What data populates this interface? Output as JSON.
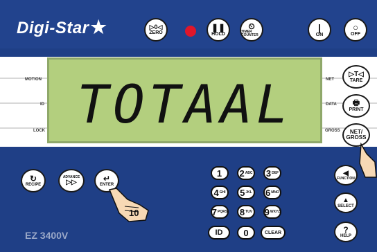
{
  "brand": {
    "name": "Digi-Star",
    "star": "★"
  },
  "top_buttons": {
    "zero": {
      "symbol": "▷0◁",
      "label": "ZERO"
    },
    "hold": {
      "symbol": "❚❚",
      "label": "HOLD"
    },
    "timer": {
      "symbol": "⏲",
      "label": "TIMER COUNTER"
    },
    "on": {
      "symbol": "|",
      "label": "ON"
    },
    "off": {
      "symbol": "○",
      "label": "OFF"
    }
  },
  "indicator_left": {
    "motion": "MOTION",
    "id": "ID",
    "lock": "LOCK"
  },
  "indicator_right": {
    "net": "NET",
    "data": "DATA",
    "gross": "GROSS"
  },
  "display_text": "TOTAAL",
  "right_buttons": {
    "tare": {
      "symbol": "▷T◁",
      "label": "TARE"
    },
    "print": {
      "symbol": "🖶",
      "label": "PRINT"
    },
    "net_gross": {
      "label1": "NET/",
      "label2": "GROSS"
    }
  },
  "bottom_buttons": {
    "recipe": {
      "symbol": "↻",
      "label": "RECIPE"
    },
    "advance": {
      "symbol": "ADVANCE",
      "label": "▷▷"
    },
    "enter": {
      "symbol": "↵",
      "label": "ENTER"
    },
    "function": {
      "symbol": "◀",
      "label": "FUNCTION"
    },
    "select": {
      "symbol": "▲",
      "label": "SELECT"
    },
    "help": {
      "symbol": "?",
      "label": "HELP"
    }
  },
  "keypad": [
    {
      "key": "1",
      "sub": ""
    },
    {
      "key": "2",
      "sub": "ABC"
    },
    {
      "key": "3",
      "sub": "DEF"
    },
    {
      "key": "4",
      "sub": "GHI"
    },
    {
      "key": "5",
      "sub": "JKL"
    },
    {
      "key": "6",
      "sub": "MNO"
    },
    {
      "key": "7",
      "sub": "PQRS"
    },
    {
      "key": "8",
      "sub": "TUV"
    },
    {
      "key": "9",
      "sub": "WXYZ"
    },
    {
      "key": "ID",
      "sub": ""
    },
    {
      "key": "0",
      "sub": ""
    },
    {
      "key": "CLEAR",
      "sub": ""
    }
  ],
  "annotation": {
    "step_number": "10"
  },
  "model": "EZ 3400V",
  "colors": {
    "body": "#1f3f86",
    "lcd": "#b3cf7e",
    "led": "#e0162a"
  }
}
